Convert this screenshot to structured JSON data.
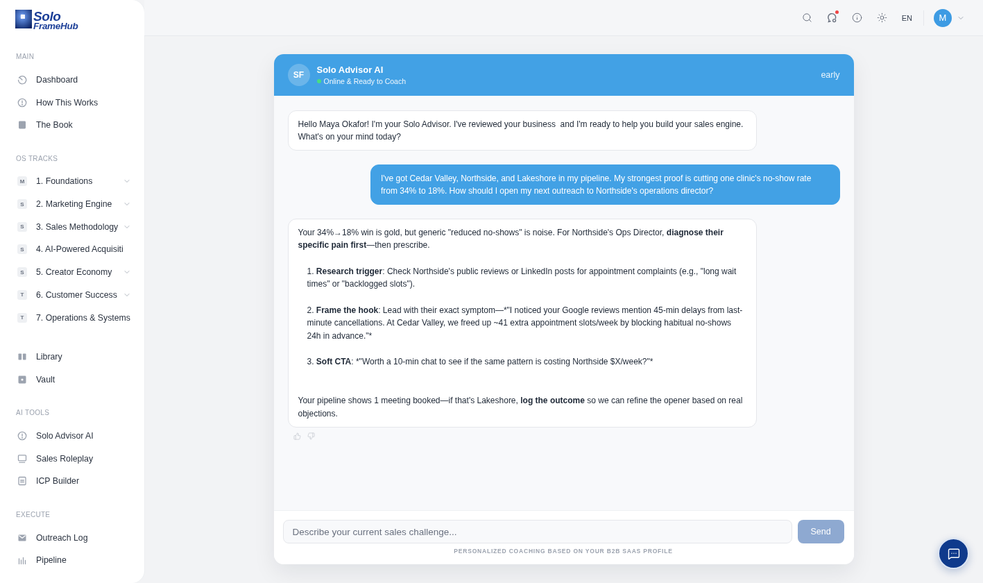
{
  "sidebar": {
    "logo": {
      "lines": [
        "Solo",
        "FrameHub"
      ]
    },
    "sections": [
      {
        "title": "MAIN",
        "items": [
          {
            "label": "Dashboard"
          },
          {
            "label": "How This Works"
          },
          {
            "label": "The Book"
          }
        ]
      },
      {
        "title": "OS TRACKS",
        "items": [
          {
            "badge": "M",
            "label": "1. Foundations",
            "expandable": true
          },
          {
            "badge": "S",
            "label": "2. Marketing Engine",
            "expandable": true
          },
          {
            "badge": "S",
            "label": "3. Sales Methodology",
            "expandable": true
          },
          {
            "badge": "S",
            "label": "4. AI-Powered Acquisiti",
            "expandable": false
          },
          {
            "badge": "S",
            "label": "5. Creator Economy",
            "expandable": true
          },
          {
            "badge": "T",
            "label": "6. Customer Success",
            "expandable": true
          },
          {
            "badge": "T",
            "label": "7. Operations & Systems",
            "expandable": false
          }
        ]
      },
      {
        "items": [
          {
            "label": "Library"
          },
          {
            "label": "Vault"
          }
        ]
      },
      {
        "title": "AI TOOLS",
        "items": [
          {
            "label": "Solo Advisor AI"
          },
          {
            "label": "Sales Roleplay"
          },
          {
            "label": "ICP Builder"
          }
        ]
      },
      {
        "title": "EXECUTE",
        "items": [
          {
            "label": "Outreach Log"
          },
          {
            "label": "Pipeline"
          }
        ]
      }
    ]
  },
  "top_bar": {
    "notification_dot": true,
    "language": "EN",
    "avatar": "M"
  },
  "chat": {
    "avatar": "SF",
    "title": "Solo Advisor AI",
    "online": true,
    "status": "Online & Ready to Coach",
    "tag": "early",
    "messages": [
      {
        "kind": "assistant",
        "blocks": [
          {
            "kind": "paragraph",
            "spans": [
              {
                "text": "Hello Maya Okafor! I'm your Solo Advisor. I've reviewed your business  and I'm ready to help you build your sales engine. What's on your mind today?",
                "bold": false
              }
            ]
          }
        ]
      },
      {
        "kind": "user",
        "blocks": [
          {
            "kind": "paragraph",
            "spans": [
              {
                "text": "I've got Cedar Valley, Northside, and Lakeshore in my pipeline. My strongest proof is cutting one clinic's no-show rate from 34% to 18%. How should I open my next outreach to Northside's operations director?",
                "bold": false
              }
            ]
          }
        ]
      },
      {
        "kind": "assistant",
        "blocks": [
          {
            "kind": "paragraph",
            "spans": [
              {
                "text": "Your 34%→18% win is gold, but generic \"reduced no-shows\" is noise. For Northside's Ops Director, ",
                "bold": false
              },
              {
                "text": "diagnose their specific pain first",
                "bold": true
              },
              {
                "text": "—then prescribe.",
                "bold": false
              }
            ]
          },
          {
            "kind": "list_item",
            "spans": [
              {
                "text": "1. ",
                "bold": false
              },
              {
                "text": "Research trigger",
                "bold": true
              },
              {
                "text": ": Check Northside's public reviews or LinkedIn posts for appointment complaints (e.g., \"long wait times\" or \"backlogged slots\").",
                "bold": false
              }
            ]
          },
          {
            "kind": "list_item",
            "spans": [
              {
                "text": "2. ",
                "bold": false
              },
              {
                "text": "Frame the hook",
                "bold": true
              },
              {
                "text": ": Lead with their exact symptom—*\"I noticed your Google reviews mention 45-min delays from last-minute cancellations. At Cedar Valley, we freed up ~41 extra appointment slots/week by blocking habitual no-shows 24h in advance.\"*",
                "bold": false
              }
            ]
          },
          {
            "kind": "list_item",
            "spans": [
              {
                "text": "3. ",
                "bold": false
              },
              {
                "text": "Soft CTA",
                "bold": true
              },
              {
                "text": ": *\"Worth a 10-min chat to see if the same pattern is costing Northside $X/week?\"*",
                "bold": false
              }
            ]
          },
          {
            "kind": "paragraph",
            "spans": [
              {
                "text": "Your pipeline shows 1 meeting booked—if that's Lakeshore, ",
                "bold": false
              },
              {
                "text": "log the outcome",
                "bold": true
              },
              {
                "text": " so we can refine the opener based on real objections.",
                "bold": false
              }
            ]
          }
        ]
      }
    ],
    "input": {
      "placeholder": "Describe your current sales challenge..."
    },
    "send_button": {
      "label": "Send",
      "disabled": true
    },
    "caption": "PERSONALIZED COACHING BASED ON YOUR B2B SAAS PROFILE"
  }
}
